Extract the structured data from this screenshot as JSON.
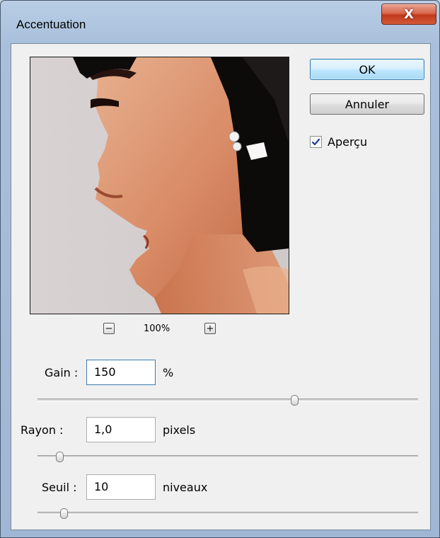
{
  "window": {
    "title": "Accentuation",
    "close_symbol": "X"
  },
  "preview": {
    "zoom_level": "100%",
    "zoom_out_symbol": "−",
    "zoom_in_symbol": "+"
  },
  "buttons": {
    "ok_label": "OK",
    "cancel_label": "Annuler"
  },
  "apercu": {
    "label": "Aperçu",
    "checked": true
  },
  "controls": {
    "gain": {
      "label": "Gain :",
      "value": "150",
      "unit": "%",
      "slider_fraction": 0.68
    },
    "rayon": {
      "label": "Rayon :",
      "value": "1,0",
      "unit": "pixels",
      "slider_fraction": 0.05
    },
    "seuil": {
      "label": "Seuil :",
      "value": "10",
      "unit": "niveaux",
      "slider_fraction": 0.06
    }
  },
  "colors": {
    "ok_border": "#3c7fb1",
    "close_red": "#c2381b",
    "dialog_bg": "#f0f0f0"
  }
}
